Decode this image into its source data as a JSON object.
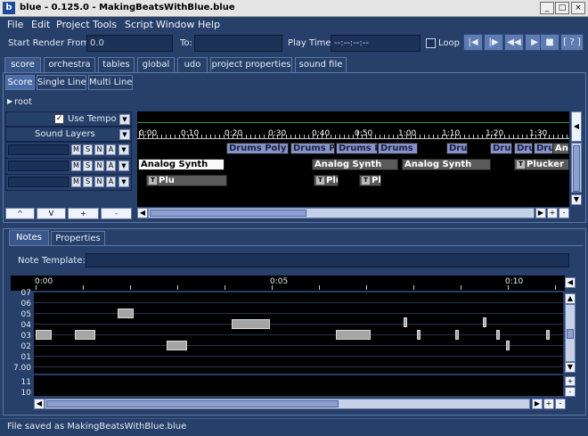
{
  "window": {
    "title": "blue - 0.125.0 - MakingBeatsWithBlue.blue",
    "icon_letter": "b",
    "controls": [
      "_",
      "□",
      "×"
    ]
  },
  "menubar": [
    "File",
    "Edit",
    "Project",
    "Tools",
    "Script",
    "Window",
    "Help"
  ],
  "toolbar": {
    "start_render_label": "Start Render From:",
    "start_render_value": "0.0",
    "to_label": "To:",
    "to_value": "",
    "play_time_label": "Play Time:",
    "play_time_value": "--:--:--:--",
    "loop_label": "Loop",
    "buttons": [
      {
        "icon": "rewind-to-start-icon",
        "glyph": "|◀"
      },
      {
        "icon": "render-marker-icon",
        "glyph": "|▶"
      },
      {
        "icon": "rewind-icon",
        "glyph": "◀◀"
      },
      {
        "icon": "play-icon",
        "glyph": "▶"
      },
      {
        "icon": "stop-icon",
        "glyph": "■"
      },
      {
        "icon": "help-icon",
        "glyph": "[ ? ]"
      }
    ]
  },
  "main_tabs": [
    "score",
    "orchestra",
    "tables",
    "global",
    "udo",
    "project properties",
    "sound file"
  ],
  "sub_tabs": [
    "Score",
    "Single Line",
    "Multi Line"
  ],
  "breadcrumb": "root",
  "layers": {
    "use_tempo_label": "Use Tempo",
    "sound_layers_label": "Sound Layers",
    "row_buttons": [
      "M",
      "S",
      "N",
      "A"
    ],
    "bottom_buttons": [
      "^",
      "V",
      "+",
      "-"
    ]
  },
  "ruler_ticks": [
    "0:00",
    "0:10",
    "0:20",
    "0:30",
    "0:40",
    "0:50",
    "1:00",
    "1:10",
    "1:20",
    "1:30"
  ],
  "score_objects": [
    {
      "label": "Drums Poly",
      "layer": 0,
      "style": "purple"
    },
    {
      "label": "Drums Po",
      "layer": 0,
      "style": "purple"
    },
    {
      "label": "Drums Po",
      "layer": 0,
      "style": "purple"
    },
    {
      "label": "Drums Po",
      "layer": 0,
      "style": "purple"
    },
    {
      "label": "Drur",
      "layer": 0,
      "style": "purple"
    },
    {
      "label": "Drur",
      "layer": 0,
      "style": "purple"
    },
    {
      "label": "Drur",
      "layer": 0,
      "style": "purple"
    },
    {
      "label": "Dru",
      "layer": 0,
      "style": "purple"
    },
    {
      "label": "Analog Synth",
      "layer": 1,
      "style": "gray"
    },
    {
      "label": "Analog Synth",
      "layer": 1,
      "style": "white"
    },
    {
      "label": "Analog Synth",
      "layer": 1,
      "style": "gray"
    },
    {
      "label": "Analog Synth",
      "layer": 1,
      "style": "gray"
    },
    {
      "label": "Plucker",
      "layer": 2,
      "style": "gray",
      "t": true
    },
    {
      "label": "Plu",
      "layer": 2,
      "style": "gray",
      "t": true
    },
    {
      "label": "Plu",
      "layer": 2,
      "style": "gray",
      "t": true
    },
    {
      "label": "Plucker",
      "layer": 2,
      "style": "gray",
      "t": true
    }
  ],
  "notes_tabs": [
    "Notes",
    "Properties"
  ],
  "note_template_label": "Note Template:",
  "note_template_value": "",
  "pianoroll": {
    "ticks": [
      "0:00",
      "0:05",
      "0:10"
    ],
    "pitches": [
      "07",
      "06",
      "05",
      "04",
      "03",
      "02",
      "01",
      "7.00"
    ],
    "lower_pitches": [
      "11",
      "10"
    ]
  },
  "status": "File saved as MakingBeatsWithBlue.blue",
  "colors": {
    "background": "#27406a",
    "score_canvas": "#000000",
    "clip_purple": "#8890c8",
    "clip_gray": "#5a5a5a"
  }
}
